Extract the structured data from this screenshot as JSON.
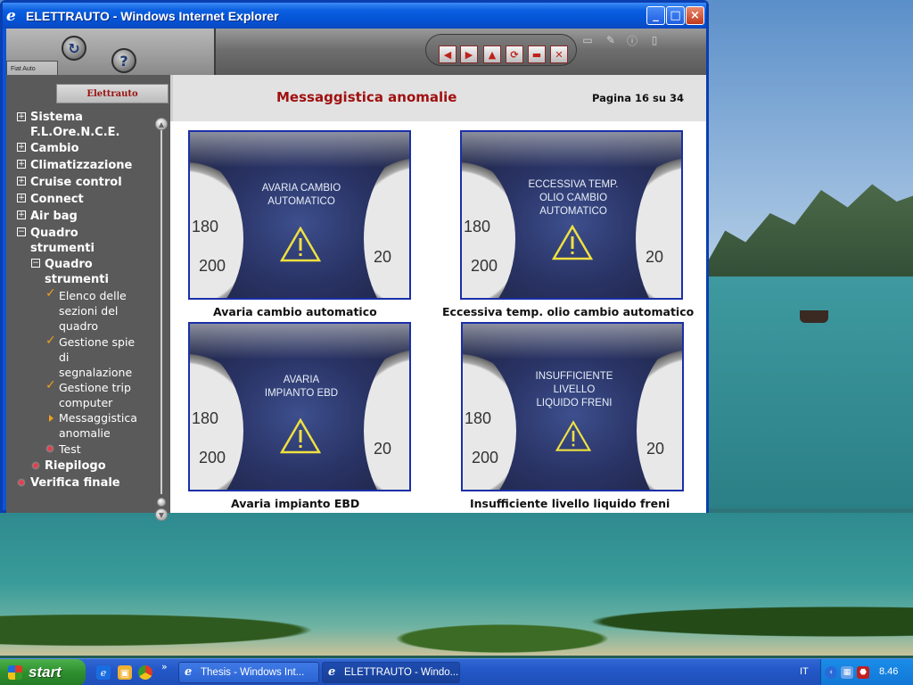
{
  "window": {
    "title": "ELETTRAUTO - Windows Internet Explorer",
    "minimize": "_",
    "maximize": "□",
    "close": "×"
  },
  "app": {
    "brand": "Fiat Auto",
    "section_tag": "Elettrauto",
    "help_glyph": "?",
    "nav_buttons": [
      "◀",
      "▶",
      "▲",
      "⟳",
      "▬",
      "✕"
    ]
  },
  "sidebar": {
    "items": [
      {
        "label": "Sistema F.L.Ore.N.C.E.",
        "icon": "plus-box-icon"
      },
      {
        "label": "Cambio",
        "icon": "plus-box-icon"
      },
      {
        "label": "Climatizzazione",
        "icon": "plus-box-icon"
      },
      {
        "label": "Cruise control",
        "icon": "plus-box-icon"
      },
      {
        "label": "Connect",
        "icon": "plus-box-icon"
      },
      {
        "label": "Air bag",
        "icon": "plus-box-icon"
      },
      {
        "label": "Quadro strumenti",
        "icon": "minus-box-icon"
      },
      {
        "label": "Quadro strumenti",
        "icon": "minus-box-icon"
      },
      {
        "label": "Elenco delle sezioni del quadro",
        "icon": "check-icon"
      },
      {
        "label": "Gestione spie di segnalazione",
        "icon": "check-icon"
      },
      {
        "label": "Gestione trip computer",
        "icon": "check-icon"
      },
      {
        "label": "Messaggistica anomalie",
        "icon": "current-arrow-icon"
      },
      {
        "label": "Test",
        "icon": "dot-icon"
      },
      {
        "label": "Riepilogo",
        "icon": "dot-icon"
      },
      {
        "label": "Verifica finale",
        "icon": "dot-icon"
      }
    ]
  },
  "main": {
    "title": "Messaggistica anomalie",
    "page": "Pagina 16 su 34",
    "figures": [
      {
        "screen_text": [
          "AVARIA CAMBIO",
          "AUTOMATICO"
        ],
        "caption": "Avaria cambio automatico"
      },
      {
        "screen_text": [
          "ECCESSIVA TEMP.",
          "OLIO CAMBIO",
          "AUTOMATICO"
        ],
        "caption": "Eccessiva temp. olio cambio automatico"
      },
      {
        "screen_text": [
          "AVARIA",
          "IMPIANTO EBD"
        ],
        "caption": "Avaria impianto EBD"
      },
      {
        "screen_text": [
          "INSUFFICIENTE",
          "LIVELLO",
          "LIQUIDO FRENI"
        ],
        "caption": "Insufficiente livello liquido freni"
      }
    ],
    "gauge_labels": {
      "left_top": "180",
      "left_bottom": "200",
      "right": "20"
    }
  },
  "taskbar": {
    "start": "start",
    "tasks": [
      "Thesis - Windows Int...",
      "ELETTRAUTO - Windo..."
    ],
    "chevron": "»",
    "language": "IT",
    "clock": "8.46"
  }
}
